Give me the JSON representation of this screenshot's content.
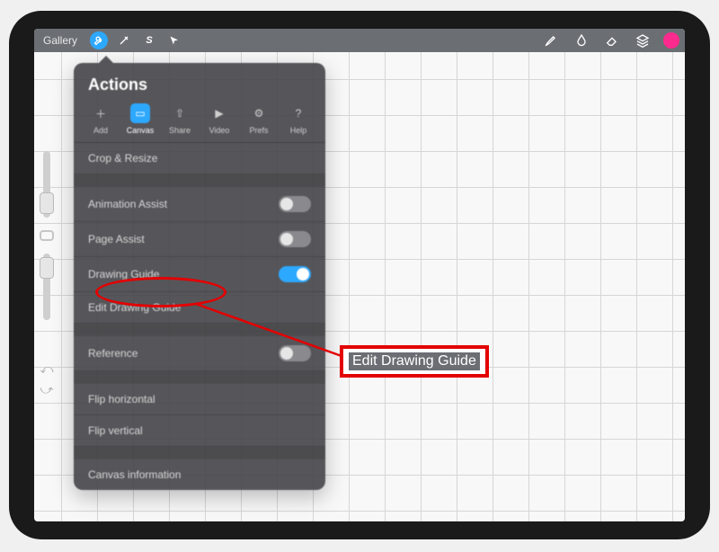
{
  "topbar": {
    "gallery_label": "Gallery"
  },
  "actions": {
    "title": "Actions",
    "tabs": [
      {
        "label": "Add",
        "glyph": "＋"
      },
      {
        "label": "Canvas",
        "glyph": "▭"
      },
      {
        "label": "Share",
        "glyph": "⇧"
      },
      {
        "label": "Video",
        "glyph": "▶"
      },
      {
        "label": "Prefs",
        "glyph": "⚙"
      },
      {
        "label": "Help",
        "glyph": "?"
      }
    ],
    "items": {
      "crop_resize": "Crop & Resize",
      "animation_assist": "Animation Assist",
      "page_assist": "Page Assist",
      "drawing_guide": "Drawing Guide",
      "edit_drawing_guide": "Edit Drawing Guide",
      "reference": "Reference",
      "flip_horizontal": "Flip horizontal",
      "flip_vertical": "Flip vertical",
      "canvas_information": "Canvas information"
    },
    "toggles": {
      "animation_assist": false,
      "page_assist": false,
      "drawing_guide": true,
      "reference": false
    }
  },
  "annotation": {
    "label": "Edit Drawing Guide"
  },
  "colors": {
    "accent": "#2da8ff",
    "brush_color": "#ff2a8d",
    "annotation_red": "#e30000"
  }
}
